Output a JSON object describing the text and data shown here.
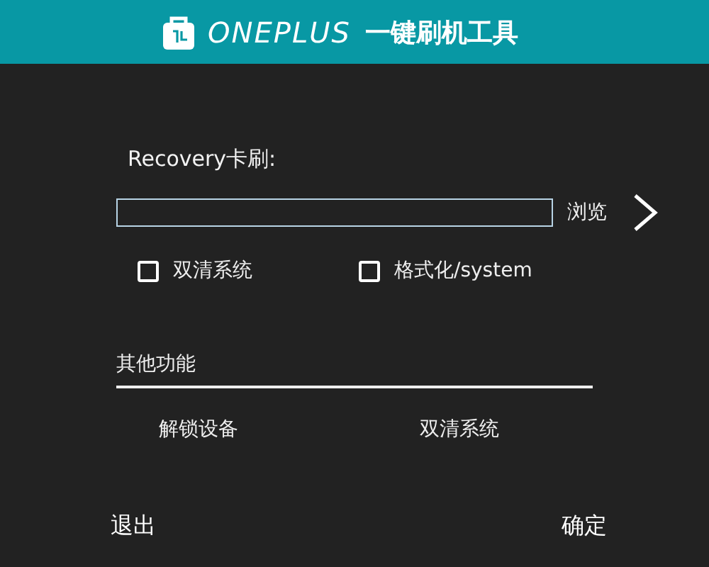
{
  "header": {
    "brand": "ONEPLUS",
    "title": "一键刷机工具"
  },
  "recovery": {
    "label": "Recovery卡刷:",
    "browse": "浏览"
  },
  "options": [
    {
      "label": "双清系统",
      "checked": false
    },
    {
      "label": "格式化/system",
      "checked": false
    }
  ],
  "other": {
    "heading": "其他功能",
    "actions": [
      "解锁设备",
      "双清系统"
    ]
  },
  "footer": {
    "exit": "退出",
    "confirm": "确定"
  }
}
